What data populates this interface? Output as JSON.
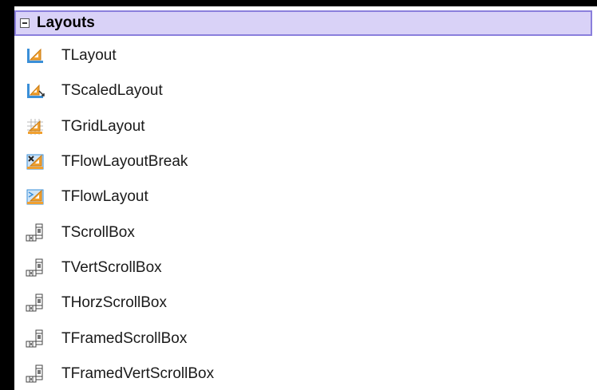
{
  "category": {
    "label": "Layouts",
    "expanded": true
  },
  "items": [
    {
      "label": "TLayout",
      "icon": "layout-icon"
    },
    {
      "label": "TScaledLayout",
      "icon": "scaled-layout-icon"
    },
    {
      "label": "TGridLayout",
      "icon": "grid-layout-icon"
    },
    {
      "label": "TFlowLayoutBreak",
      "icon": "flow-layout-break-icon"
    },
    {
      "label": "TFlowLayout",
      "icon": "flow-layout-icon"
    },
    {
      "label": "TScrollBox",
      "icon": "scrollbox-icon"
    },
    {
      "label": "TVertScrollBox",
      "icon": "scrollbox-icon"
    },
    {
      "label": "THorzScrollBox",
      "icon": "scrollbox-icon"
    },
    {
      "label": "TFramedScrollBox",
      "icon": "scrollbox-icon"
    },
    {
      "label": "TFramedVertScrollBox",
      "icon": "scrollbox-icon"
    }
  ],
  "colors": {
    "header_background": "#d9d2f7",
    "header_border": "#8a7fdc",
    "layout_icon_orange": "#f0a030",
    "layout_icon_blue": "#3a8fd8"
  }
}
